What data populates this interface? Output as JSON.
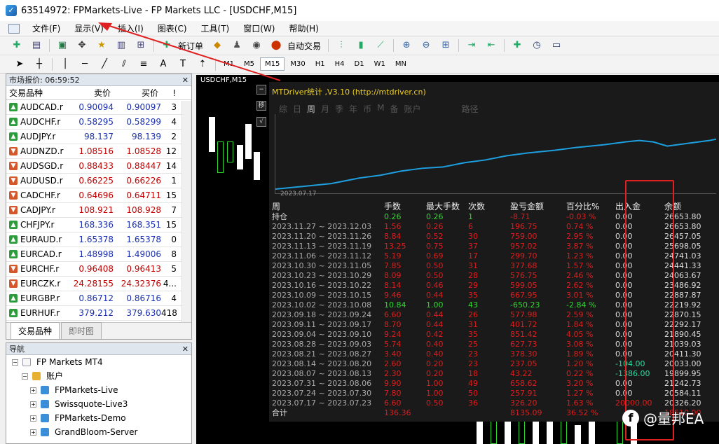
{
  "window": {
    "title": "63514972: FPMarkets-Live - FP Markets LLC - [USDCHF,M15]"
  },
  "menu": [
    "文件(F)",
    "显示(V)",
    "插入(I)",
    "图表(C)",
    "工具(T)",
    "窗口(W)",
    "帮助(H)"
  ],
  "toolbar": {
    "new_order": "新订单",
    "auto_trade": "自动交易"
  },
  "timeframes": [
    "M1",
    "M5",
    "M15",
    "M30",
    "H1",
    "H4",
    "D1",
    "W1",
    "MN"
  ],
  "active_timeframe": "M15",
  "market_watch": {
    "header": "市场报价: 06:59:52",
    "col_symbol": "交易品种",
    "col_bid": "卖价",
    "col_ask": "买价",
    "col_spread": "!",
    "rows": [
      {
        "symbol": "AUDCAD.r",
        "bid": "0.90094",
        "ask": "0.90097",
        "spread": "3",
        "dir": "up"
      },
      {
        "symbol": "AUDCHF.r",
        "bid": "0.58295",
        "ask": "0.58299",
        "spread": "4",
        "dir": "up"
      },
      {
        "symbol": "AUDJPY.r",
        "bid": "98.137",
        "ask": "98.139",
        "spread": "2",
        "dir": "up"
      },
      {
        "symbol": "AUDNZD.r",
        "bid": "1.08516",
        "ask": "1.08528",
        "spread": "12",
        "dir": "down"
      },
      {
        "symbol": "AUDSGD.r",
        "bid": "0.88433",
        "ask": "0.88447",
        "spread": "14",
        "dir": "down"
      },
      {
        "symbol": "AUDUSD.r",
        "bid": "0.66225",
        "ask": "0.66226",
        "spread": "1",
        "dir": "down"
      },
      {
        "symbol": "CADCHF.r",
        "bid": "0.64696",
        "ask": "0.64711",
        "spread": "15",
        "dir": "down"
      },
      {
        "symbol": "CADJPY.r",
        "bid": "108.921",
        "ask": "108.928",
        "spread": "7",
        "dir": "down"
      },
      {
        "symbol": "CHFJPY.r",
        "bid": "168.336",
        "ask": "168.351",
        "spread": "15",
        "dir": "up"
      },
      {
        "symbol": "EURAUD.r",
        "bid": "1.65378",
        "ask": "1.65378",
        "spread": "0",
        "dir": "up"
      },
      {
        "symbol": "EURCAD.r",
        "bid": "1.48998",
        "ask": "1.49006",
        "spread": "8",
        "dir": "up"
      },
      {
        "symbol": "EURCHF.r",
        "bid": "0.96408",
        "ask": "0.96413",
        "spread": "5",
        "dir": "down"
      },
      {
        "symbol": "EURCZK.r",
        "bid": "24.28155",
        "ask": "24.32376",
        "spread": "4...",
        "dir": "down"
      },
      {
        "symbol": "EURGBP.r",
        "bid": "0.86712",
        "ask": "0.86716",
        "spread": "4",
        "dir": "up"
      },
      {
        "symbol": "EURHUF.r",
        "bid": "379.212",
        "ask": "379.630",
        "spread": "418",
        "dir": "up"
      }
    ],
    "tab_symbols": "交易品种",
    "tab_tick": "即时图"
  },
  "navigator": {
    "header": "导航",
    "root": "FP Markets MT4",
    "accounts": "账户",
    "items": [
      "FPMarkets-Live",
      "Swissquote-Live3",
      "FPMarkets-Demo",
      "GrandBloom-Server"
    ]
  },
  "chart": {
    "label": "USDCHF,M15"
  },
  "overlay": {
    "title": "MTDriver统计 ,V3.10 (http://mtdriver.cn)",
    "tabs": [
      "综",
      "日",
      "周",
      "月",
      "季",
      "年",
      "币",
      "M",
      "备",
      "账户",
      "路径"
    ],
    "active_tab": "周",
    "graph_start_date": "2023.07.17",
    "headers": [
      "周",
      "手数",
      "最大手数",
      "次数",
      "盈亏金额",
      "百分比%",
      "出入金",
      "余额"
    ],
    "rows": [
      [
        "持仓",
        "0.26",
        "0.26",
        "1",
        "-8.71",
        "-0.03 %",
        "0.00",
        "26653.80"
      ],
      [
        "2023.11.27 ~ 2023.12.03",
        "1.56",
        "0.26",
        "6",
        "196.75",
        "0.74 %",
        "0.00",
        "26653.80"
      ],
      [
        "2023.11.20 ~ 2023.11.26",
        "8.84",
        "0.52",
        "30",
        "759.00",
        "2.95 %",
        "0.00",
        "26457.05"
      ],
      [
        "2023.11.13 ~ 2023.11.19",
        "13.25",
        "0.75",
        "37",
        "957.02",
        "3.87 %",
        "0.00",
        "25698.05"
      ],
      [
        "2023.11.06 ~ 2023.11.12",
        "5.19",
        "0.69",
        "17",
        "299.70",
        "1.23 %",
        "0.00",
        "24741.03"
      ],
      [
        "2023.10.30 ~ 2023.11.05",
        "7.85",
        "0.50",
        "31",
        "377.68",
        "1.57 %",
        "0.00",
        "24441.33"
      ],
      [
        "2023.10.23 ~ 2023.10.29",
        "8.09",
        "0.50",
        "28",
        "576.75",
        "2.46 %",
        "0.00",
        "24063.67"
      ],
      [
        "2023.10.16 ~ 2023.10.22",
        "8.14",
        "0.46",
        "29",
        "599.05",
        "2.62 %",
        "0.00",
        "23486.92"
      ],
      [
        "2023.10.09 ~ 2023.10.15",
        "9.46",
        "0.44",
        "35",
        "667.95",
        "3.01 %",
        "0.00",
        "22887.87"
      ],
      [
        "2023.10.02 ~ 2023.10.08",
        "10.84",
        "1.00",
        "43",
        "-650.23",
        "-2.84 %",
        "0.00",
        "22219.92"
      ],
      [
        "2023.09.18 ~ 2023.09.24",
        "6.60",
        "0.44",
        "26",
        "577.98",
        "2.59 %",
        "0.00",
        "22870.15"
      ],
      [
        "2023.09.11 ~ 2023.09.17",
        "8.70",
        "0.44",
        "31",
        "401.72",
        "1.84 %",
        "0.00",
        "22292.17"
      ],
      [
        "2023.09.04 ~ 2023.09.10",
        "9.24",
        "0.42",
        "35",
        "851.42",
        "4.05 %",
        "0.00",
        "21890.45"
      ],
      [
        "2023.08.28 ~ 2023.09.03",
        "5.74",
        "0.40",
        "25",
        "627.73",
        "3.08 %",
        "0.00",
        "21039.03"
      ],
      [
        "2023.08.21 ~ 2023.08.27",
        "3.40",
        "0.40",
        "23",
        "378.30",
        "1.89 %",
        "0.00",
        "20411.30"
      ],
      [
        "2023.08.14 ~ 2023.08.20",
        "2.60",
        "0.20",
        "23",
        "237.05",
        "1.20 %",
        "-104.00",
        "20033.00"
      ],
      [
        "2023.08.07 ~ 2023.08.13",
        "2.30",
        "0.20",
        "18",
        "43.22",
        "0.22 %",
        "-1386.00",
        "19899.95"
      ],
      [
        "2023.07.31 ~ 2023.08.06",
        "9.90",
        "1.00",
        "49",
        "658.62",
        "3.20 %",
        "0.00",
        "21242.73"
      ],
      [
        "2023.07.24 ~ 2023.07.30",
        "7.80",
        "1.00",
        "50",
        "257.91",
        "1.27 %",
        "0.00",
        "20584.11"
      ],
      [
        "2023.07.17 ~ 2023.07.23",
        "6.60",
        "0.50",
        "36",
        "326.20",
        "1.63 %",
        "20000.00",
        "20326.20"
      ]
    ],
    "total": [
      "合计",
      "136.36",
      "",
      "",
      "8135.09",
      "36.52 %",
      "",
      "18510.00"
    ]
  },
  "watermark": "@量邦EA"
}
